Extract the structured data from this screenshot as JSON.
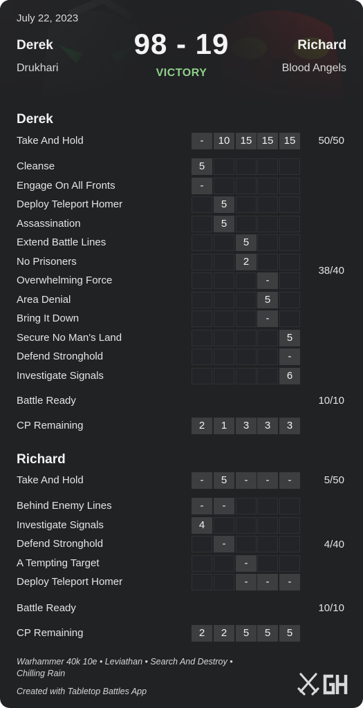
{
  "header": {
    "date": "July 22, 2023",
    "player1": {
      "name": "Derek",
      "faction": "Drukhari"
    },
    "player2": {
      "name": "Richard",
      "faction": "Blood Angels"
    },
    "score": "98 - 19",
    "result": "VICTORY"
  },
  "derek": {
    "title": "Derek",
    "take_and_hold": {
      "label": "Take And Hold",
      "values": [
        "-",
        "10",
        "15",
        "15",
        "15"
      ],
      "total": "50/50"
    },
    "secondaries": [
      {
        "label": "Cleanse",
        "values": [
          "5",
          "",
          "",
          "",
          ""
        ]
      },
      {
        "label": "Engage On All Fronts",
        "values": [
          "-",
          "",
          "",
          "",
          ""
        ]
      },
      {
        "label": "Deploy Teleport Homer",
        "values": [
          "",
          "5",
          "",
          "",
          ""
        ]
      },
      {
        "label": "Assassination",
        "values": [
          "",
          "5",
          "",
          "",
          ""
        ]
      },
      {
        "label": "Extend Battle Lines",
        "values": [
          "",
          "",
          "5",
          "",
          ""
        ]
      },
      {
        "label": "No Prisoners",
        "values": [
          "",
          "",
          "2",
          "",
          ""
        ]
      },
      {
        "label": "Overwhelming Force",
        "values": [
          "",
          "",
          "",
          "-",
          ""
        ]
      },
      {
        "label": "Area Denial",
        "values": [
          "",
          "",
          "",
          "5",
          ""
        ]
      },
      {
        "label": "Bring It Down",
        "values": [
          "",
          "",
          "",
          "-",
          ""
        ]
      },
      {
        "label": "Secure No Man's Land",
        "values": [
          "",
          "",
          "",
          "",
          "5"
        ]
      },
      {
        "label": "Defend Stronghold",
        "values": [
          "",
          "",
          "",
          "",
          "-"
        ]
      },
      {
        "label": "Investigate Signals",
        "values": [
          "",
          "",
          "",
          "",
          "6"
        ]
      }
    ],
    "secondary_total": "38/40",
    "battle_ready": {
      "label": "Battle Ready",
      "total": "10/10"
    },
    "cp": {
      "label": "CP Remaining",
      "values": [
        "2",
        "1",
        "3",
        "3",
        "3"
      ]
    }
  },
  "richard": {
    "title": "Richard",
    "take_and_hold": {
      "label": "Take And Hold",
      "values": [
        "-",
        "5",
        "-",
        "-",
        "-"
      ],
      "total": "5/50"
    },
    "secondaries": [
      {
        "label": "Behind Enemy Lines",
        "values": [
          "-",
          "-",
          "",
          "",
          ""
        ]
      },
      {
        "label": "Investigate Signals",
        "values": [
          "4",
          "",
          "",
          "",
          ""
        ]
      },
      {
        "label": "Defend Stronghold",
        "values": [
          "",
          "-",
          "",
          "",
          ""
        ]
      },
      {
        "label": "A Tempting Target",
        "values": [
          "",
          "",
          "-",
          "",
          ""
        ]
      },
      {
        "label": "Deploy Teleport Homer",
        "values": [
          "",
          "",
          "-",
          "-",
          "-"
        ]
      }
    ],
    "secondary_total": "4/40",
    "battle_ready": {
      "label": "Battle Ready",
      "total": "10/10"
    },
    "cp": {
      "label": "CP Remaining",
      "values": [
        "2",
        "2",
        "5",
        "5",
        "5"
      ]
    }
  },
  "footer": {
    "line1": "Warhammer 40k 10e • Leviathan • Search And Destroy •",
    "line2": "Chilling Rain",
    "credit": "Created with Tabletop Battles App"
  }
}
